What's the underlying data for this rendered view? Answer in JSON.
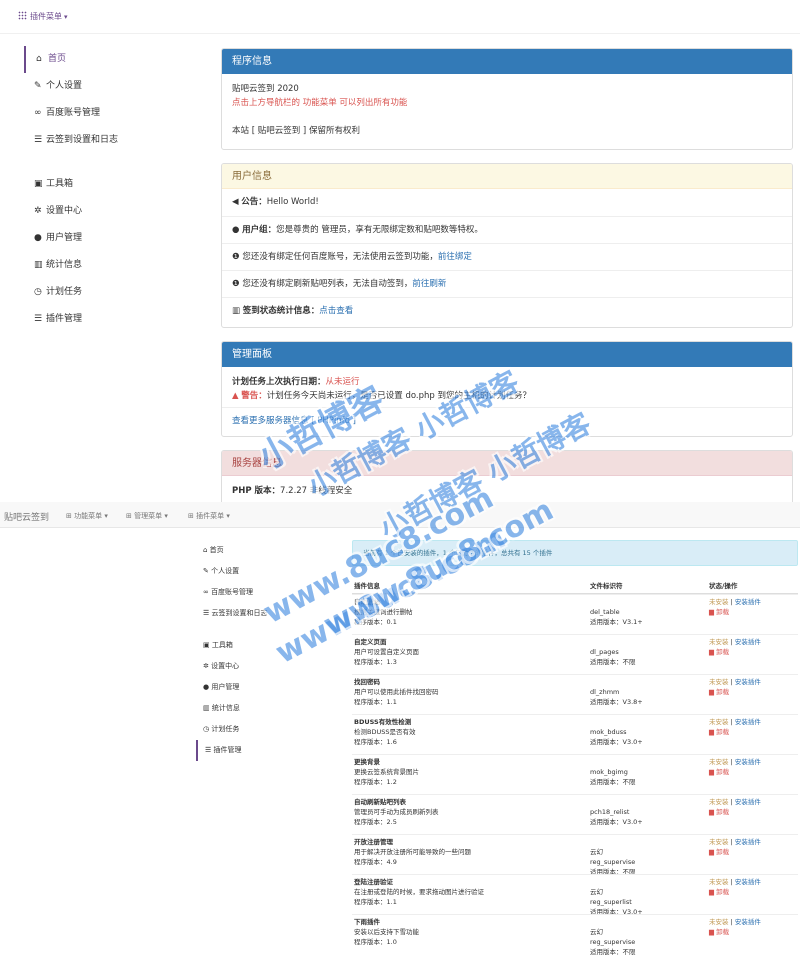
{
  "top": {
    "navbar": {
      "menu_label": "插件菜单"
    },
    "sidebar": {
      "group1": [
        {
          "label": "首页",
          "icon": "home-icon"
        },
        {
          "label": "个人设置",
          "icon": "wrench-icon"
        },
        {
          "label": "百度账号管理",
          "icon": "link-icon"
        },
        {
          "label": "云签到设置和日志",
          "icon": "list-icon"
        }
      ],
      "group2": [
        {
          "label": "工具箱",
          "icon": "briefcase-icon"
        },
        {
          "label": "设置中心",
          "icon": "gear-icon"
        },
        {
          "label": "用户管理",
          "icon": "user-icon"
        },
        {
          "label": "统计信息",
          "icon": "chart-icon"
        },
        {
          "label": "计划任务",
          "icon": "clock-icon"
        },
        {
          "label": "插件管理",
          "icon": "list-icon"
        }
      ]
    },
    "program_info": {
      "title": "程序信息",
      "line1": "贴吧云签到 2020",
      "line2": "点击上方导航栏的 功能菜单 可以列出所有功能",
      "line3": "本站 [ 贴吧云签到 ] 保留所有权利"
    },
    "user_info": {
      "title": "用户信息",
      "notice_label": "公告：",
      "notice_value": "Hello World!",
      "group_label": "用户组：",
      "group_value": "您是尊贵的 管理员，享有无限绑定数和贴吧数等特权。",
      "bind_text": "您还没有绑定任何百度账号，无法使用云签到功能，",
      "bind_link": "前往绑定",
      "refresh_text": "您还没有绑定刷新贴吧列表，无法自动签到，",
      "refresh_link": "前往刷新",
      "stats_label": "签到状态统计信息：",
      "stats_link": "点击查看"
    },
    "admin_panel": {
      "title": "管理面板",
      "cron_label": "计划任务上次执行日期：",
      "cron_value": "从未运行",
      "warning_label": "警告：",
      "warning_text": "计划任务今天尚未运行，是否已设置 do.php 到您的主机的计划任务？",
      "more_link": "查看更多服务器信息 [ PHPInfo ]"
    },
    "server_info": {
      "title": "服务器信息",
      "php_label": "PHP 版本：",
      "php_value": "7.2.27 非线程安全"
    }
  },
  "bottom": {
    "navbar": {
      "brand": "贴吧云签到",
      "menus": [
        "功能菜单",
        "管理菜单",
        "插件菜单"
      ]
    },
    "sidebar": {
      "group1": [
        "首页",
        "个人设置",
        "百度账号管理",
        "云签到设置和日志"
      ],
      "group2": [
        "工具箱",
        "设置中心",
        "用户管理",
        "统计信息",
        "计划任务",
        "插件管理"
      ]
    },
    "alert": "当前有 1 个已安装的插件，1 个已激活的插件，总共有 15 个插件",
    "table": {
      "headers": [
        "插件信息",
        "文件标识符",
        "状态/操作"
      ],
      "rows": [
        {
          "name": "自动删帖",
          "desc": "根据关键词进行删帖",
          "ver": "程序版本：0.1",
          "id": "del_table",
          "req": "适用版本：V3.1+",
          "id2": ""
        },
        {
          "name": "自定义页面",
          "desc": "用户可设置自定义页面",
          "ver": "程序版本：1.3",
          "id": "dl_pages",
          "req": "适用版本：不限",
          "id2": ""
        },
        {
          "name": "找回密码",
          "desc": "用户可以使用此插件找回密码",
          "ver": "程序版本：1.1",
          "id": "dl_zhmm",
          "req": "适用版本：V3.8+",
          "id2": ""
        },
        {
          "name": "BDUSS有效性检测",
          "desc": "检测BDUSS是否有效",
          "ver": "程序版本：1.6",
          "id": "mok_bduss",
          "req": "适用版本：V3.0+",
          "id2": ""
        },
        {
          "name": "更换背景",
          "desc": "更换云签系统背景图片",
          "ver": "程序版本：1.2",
          "id": "mok_bgimg",
          "req": "适用版本：不限",
          "id2": ""
        },
        {
          "name": "自动刷新贴吧列表",
          "desc": "管理员可手动为成员刷新列表",
          "ver": "程序版本：2.5",
          "id": "pch18_relist",
          "req": "适用版本：V3.0+",
          "id2": ""
        },
        {
          "name": "开放注册管理",
          "desc": "用于解决开放注册所可能导致的一些问题",
          "ver": "程序版本：4.9",
          "id": "云幻",
          "req": "适用版本：不限",
          "id2": "reg_supervise"
        },
        {
          "name": "登陆注册验证",
          "desc": "在注册或登陆的时候，要求拖动图片进行验证",
          "ver": "程序版本：1.1",
          "id": "云幻",
          "req": "适用版本：V3.0+",
          "id2": "reg_superlist"
        },
        {
          "name": "下雨插件",
          "desc": "安装以后支持下雪功能",
          "ver": "程序版本：1.0",
          "id": "云幻",
          "req": "适用版本：不限",
          "id2": "reg_supervise"
        }
      ],
      "status_uninstalled": "未安装",
      "status_sep": "|",
      "status_install": "安装插件",
      "status_uninstall": "卸载"
    }
  },
  "watermarks": [
    "小哲博客",
    "小哲博客 小哲博客",
    "小哲博客 小哲博客",
    "www.8uc8.com",
    "www.8uc8.com",
    "www.8uc8.com"
  ],
  "colors": {
    "brand": "#6b4a8c",
    "primary": "#337ab7",
    "danger": "#d9534f",
    "link": "#2a6fb0"
  }
}
